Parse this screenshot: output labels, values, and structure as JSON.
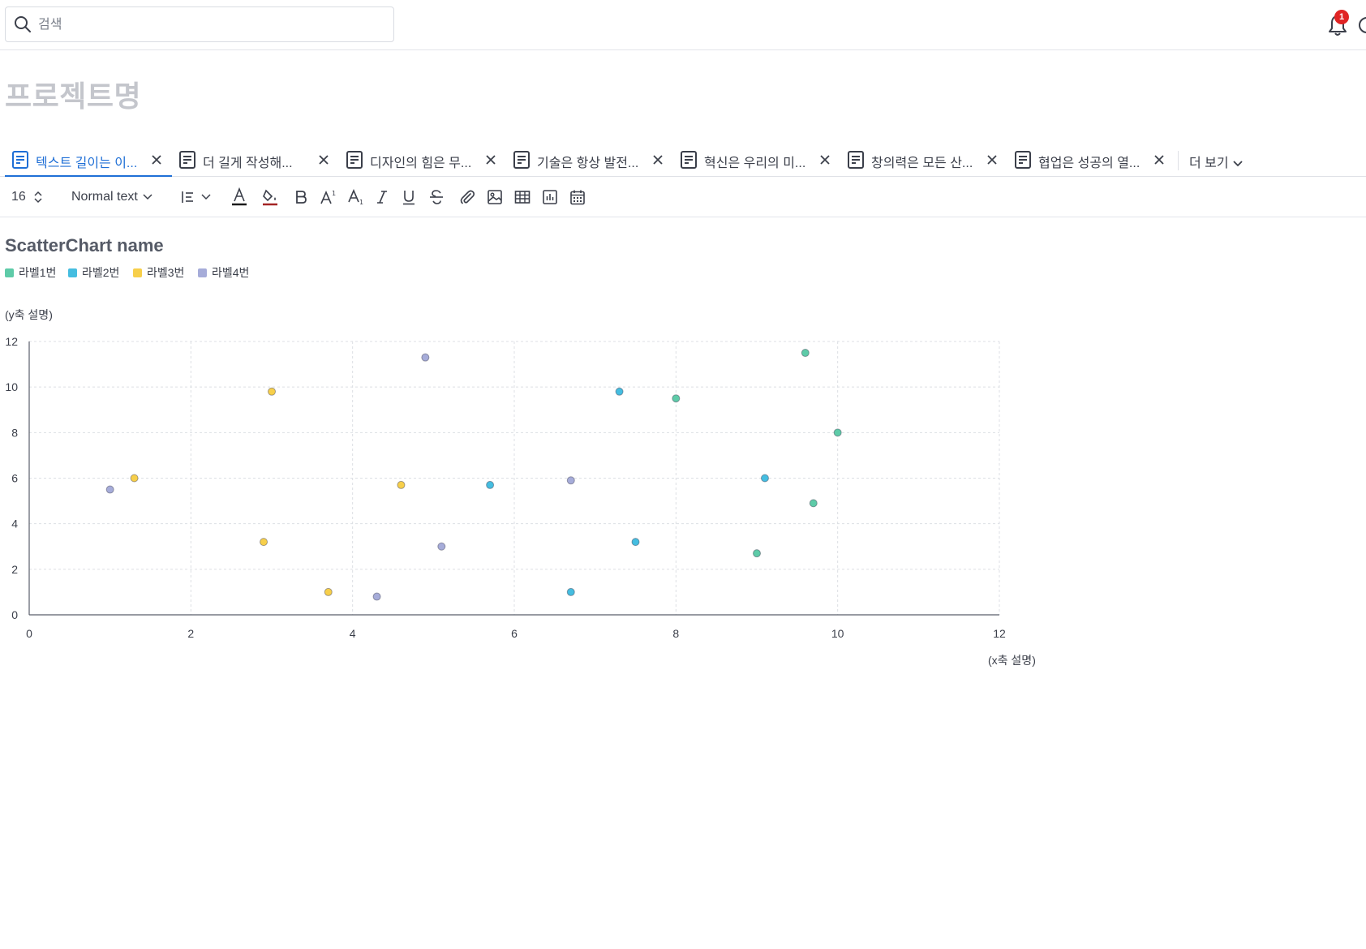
{
  "search": {
    "placeholder": "검색"
  },
  "notifications": {
    "count": "1"
  },
  "page": {
    "title": "프로젝트명"
  },
  "tabs": [
    {
      "label": "텍스트 길이는 이...",
      "active": true
    },
    {
      "label": "더 길게 작성해...",
      "active": false
    },
    {
      "label": "디자인의 힘은 무...",
      "active": false
    },
    {
      "label": "기술은 항상 발전...",
      "active": false
    },
    {
      "label": "혁신은 우리의 미...",
      "active": false
    },
    {
      "label": "창의력은 모든 산...",
      "active": false
    },
    {
      "label": "협업은 성공의 열...",
      "active": false
    }
  ],
  "tabs_more_label": "더 보기",
  "toolbar": {
    "font_size": "16",
    "text_style": "Normal text",
    "icons": [
      "align-icon",
      "text-color-icon",
      "highlight-icon",
      "bold-icon",
      "superscript-icon",
      "subscript-icon",
      "italic-icon",
      "underline-icon",
      "strikethrough-icon",
      "attachment-icon",
      "image-icon",
      "table-icon",
      "chart-icon",
      "calendar-icon"
    ]
  },
  "chart_data": {
    "type": "scatter",
    "title": "ScatterChart name",
    "xlabel": "(x축 설명)",
    "ylabel": "(y축 설명)",
    "xlim": [
      0,
      12
    ],
    "ylim": [
      0,
      12
    ],
    "xticks": [
      "0",
      "2",
      "4",
      "6",
      "8",
      "10",
      "12"
    ],
    "yticks": [
      "0",
      "2",
      "4",
      "6",
      "8",
      "10",
      "12"
    ],
    "grid": true,
    "legend_position": "top-left",
    "series": [
      {
        "name": "라벨1번",
        "color": "#5ecba8",
        "points": [
          [
            9.6,
            11.5
          ],
          [
            8.0,
            9.5
          ],
          [
            10.0,
            8.0
          ],
          [
            9.7,
            4.9
          ],
          [
            9.0,
            2.7
          ]
        ]
      },
      {
        "name": "라벨2번",
        "color": "#45bde0",
        "points": [
          [
            7.3,
            9.8
          ],
          [
            9.1,
            6.0
          ],
          [
            5.7,
            5.7
          ],
          [
            7.5,
            3.2
          ],
          [
            6.7,
            1.0
          ]
        ]
      },
      {
        "name": "라벨3번",
        "color": "#f7cf4a",
        "points": [
          [
            3.0,
            9.8
          ],
          [
            1.3,
            6.0
          ],
          [
            4.6,
            5.7
          ],
          [
            2.9,
            3.2
          ],
          [
            3.7,
            1.0
          ]
        ]
      },
      {
        "name": "라벨4번",
        "color": "#a6acd9",
        "points": [
          [
            4.9,
            11.3
          ],
          [
            1.0,
            5.5
          ],
          [
            6.7,
            5.9
          ],
          [
            5.1,
            3.0
          ],
          [
            4.3,
            0.8
          ]
        ]
      }
    ]
  }
}
